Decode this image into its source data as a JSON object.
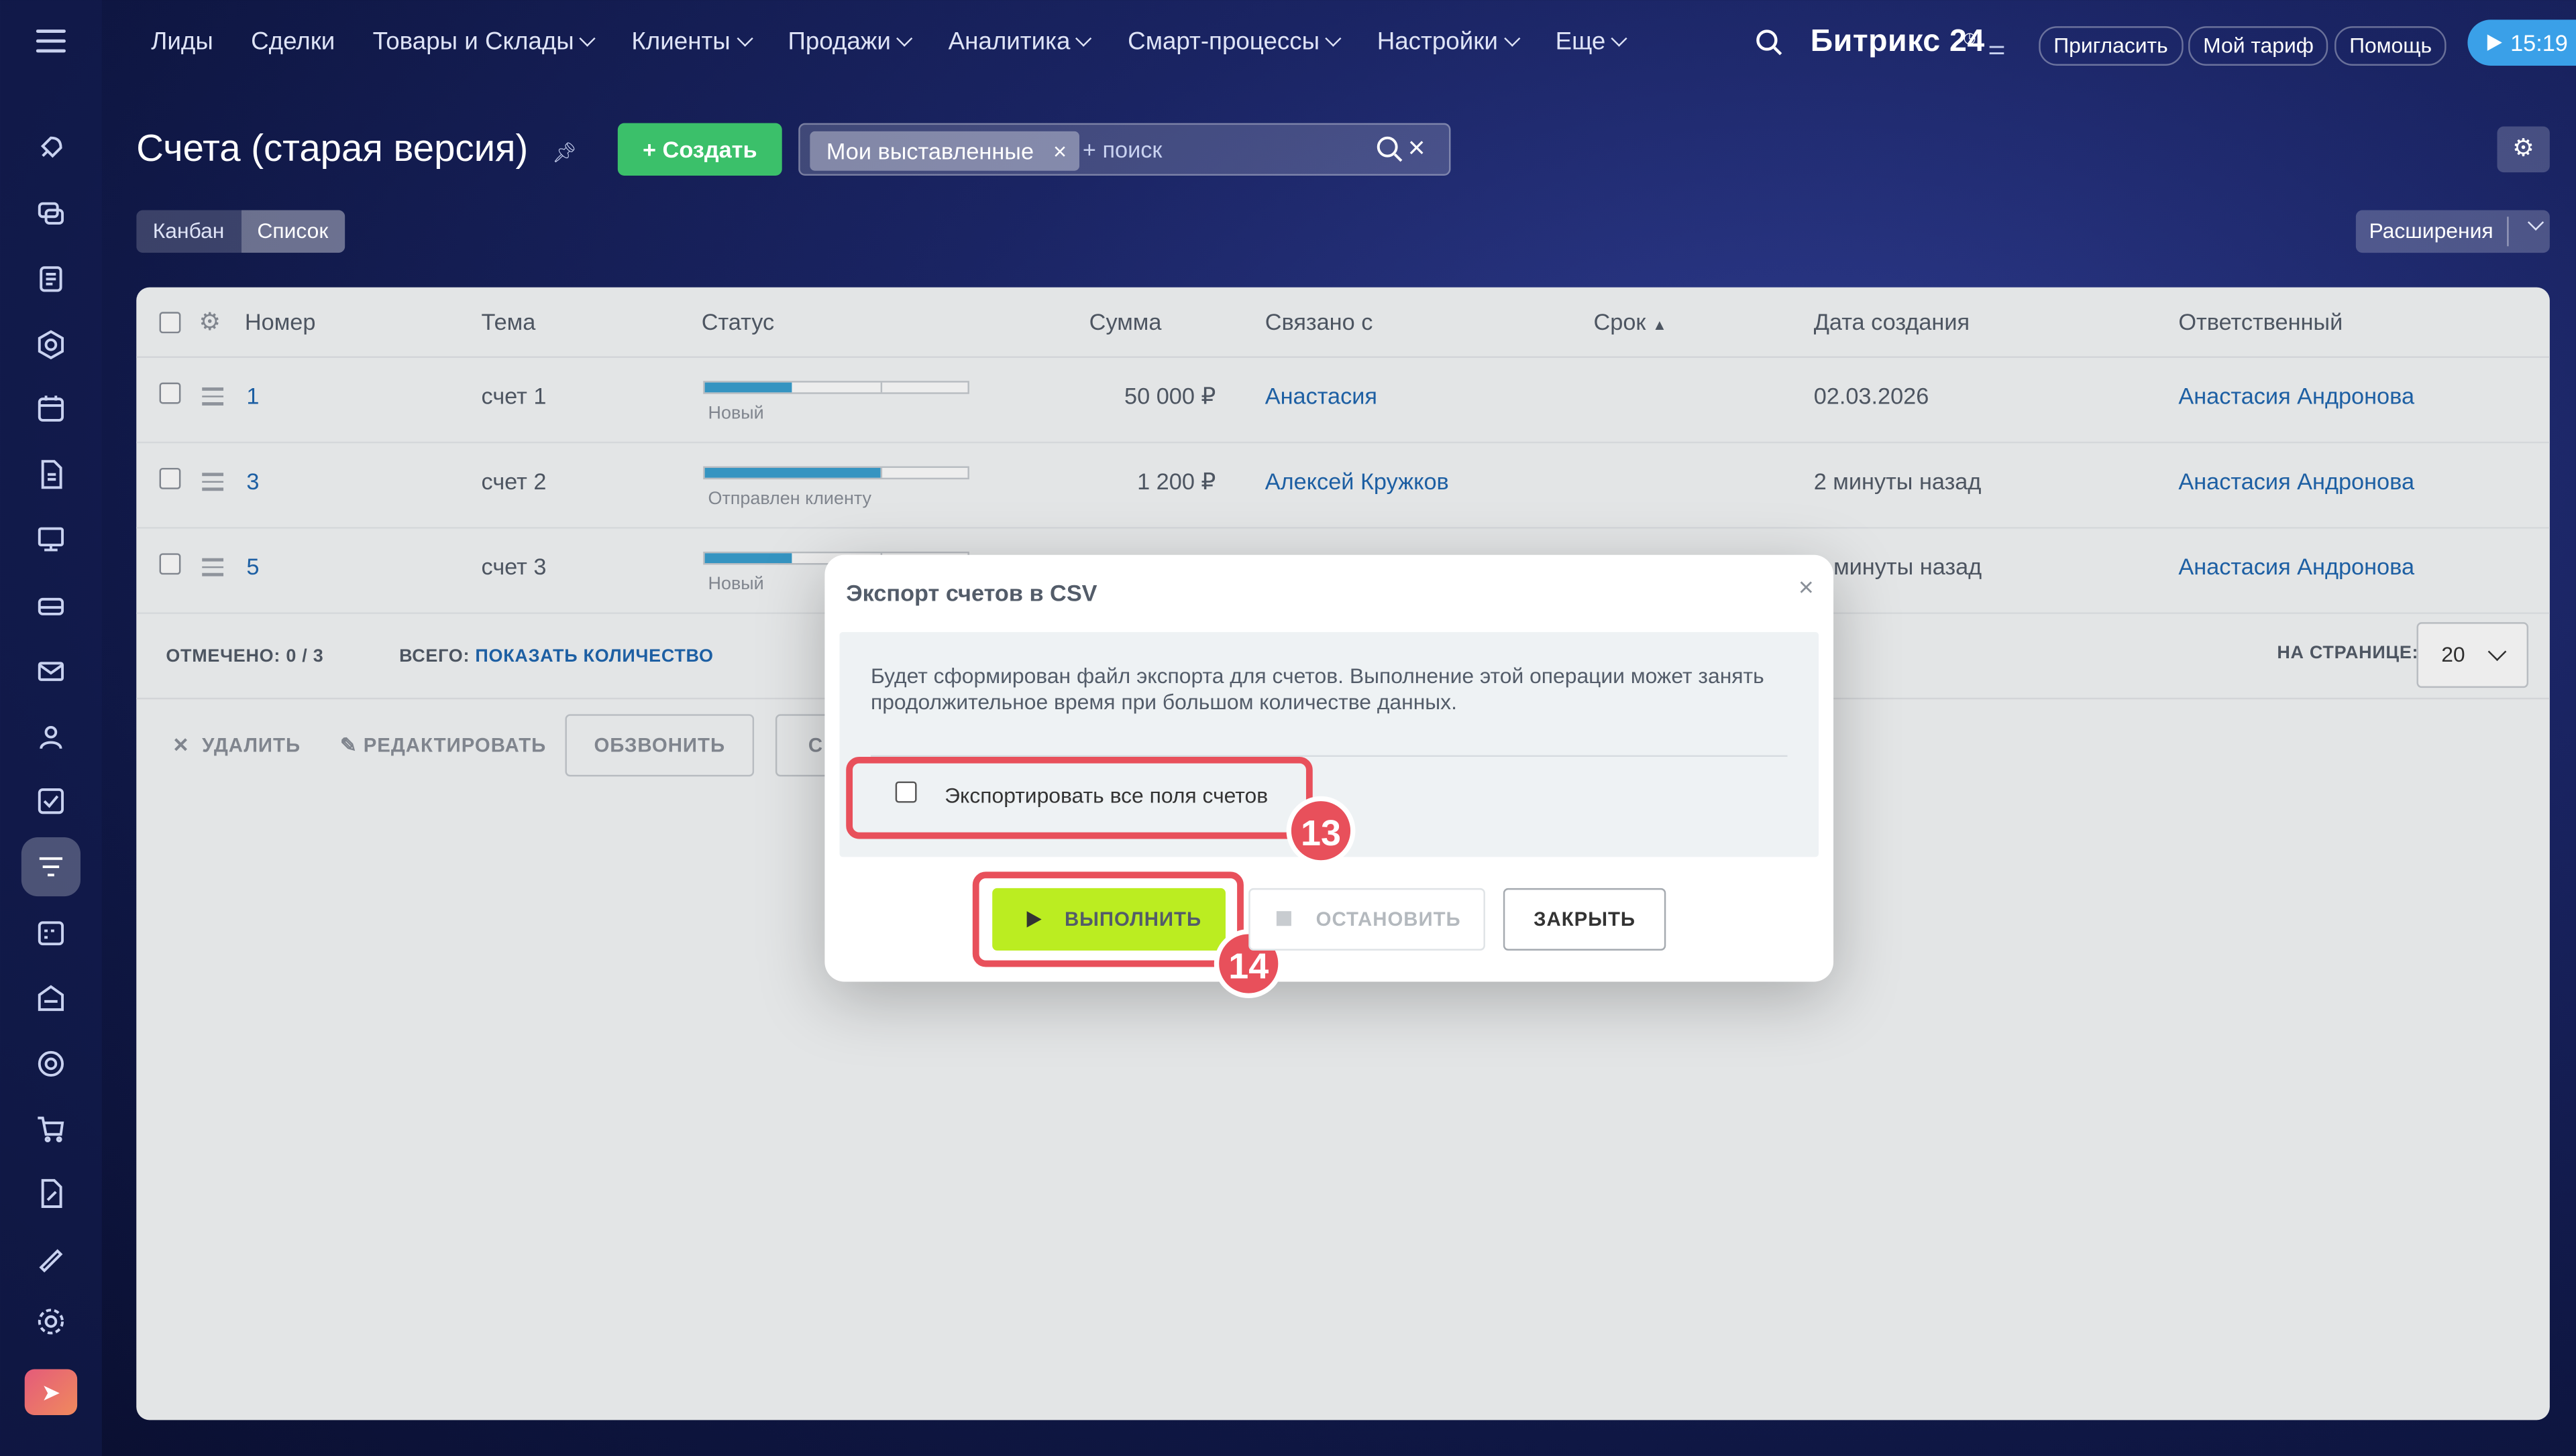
{
  "topnav": {
    "items": [
      "Лиды",
      "Сделки",
      "Товары и Склады",
      "Клиенты",
      "Продажи",
      "Аналитика",
      "Смарт-процессы",
      "Настройки",
      "Еще"
    ],
    "brand": "Битрикс 24",
    "invite": "Пригласить",
    "tariff": "Мой тариф",
    "help": "Помощь",
    "time": "15:19"
  },
  "header": {
    "title": "Счета (старая версия)",
    "create": "Создать",
    "filter_chip": "Мои выставленные",
    "search_placeholder": "+ поиск",
    "view_kanban": "Канбан",
    "view_list": "Список",
    "extensions": "Расширения"
  },
  "table": {
    "columns": [
      "Номер",
      "Тема",
      "Статус",
      "Сумма",
      "Связано с",
      "Срок",
      "Дата создания",
      "Ответственный"
    ],
    "rows": [
      {
        "num": "1",
        "topic": "счет 1",
        "status": "Новый",
        "progress": 0.33,
        "sum": "50 000 ₽",
        "related": "Анастасия",
        "created": "02.03.2026",
        "owner": "Анастасия Андронова"
      },
      {
        "num": "3",
        "topic": "счет 2",
        "status": "Отправлен клиенту",
        "progress": 0.66,
        "sum": "1 200 ₽",
        "related": "Алексей Кружков",
        "created": "2 минуты назад",
        "owner": "Анастасия Андронова"
      },
      {
        "num": "5",
        "topic": "счет 3",
        "status": "Новый",
        "progress": 0.33,
        "sum": "",
        "related": "",
        "created": "минуты назад",
        "owner": "Анастасия Андронова"
      }
    ],
    "selected_label": "ОТМЕЧЕНО:",
    "selected_value": "0 / 3",
    "total_label": "ВСЕГО:",
    "total_link": "ПОКАЗАТЬ КОЛИЧЕСТВО",
    "per_page_label": "НА СТРАНИЦЕ:",
    "per_page_value": "20",
    "actions": {
      "delete": "УДАЛИТЬ",
      "edit": "РЕДАКТИРОВАТЬ",
      "call": "ОБЗВОНИТЬ",
      "more": "С"
    }
  },
  "modal": {
    "title": "Экспорт счетов в CSV",
    "text": "Будет сформирован файл экспорта для счетов. Выполнение этой операции может занять продолжительное время при большом количестве данных.",
    "checkbox_label": "Экспортировать все поля счетов",
    "run": "ВЫПОЛНИТЬ",
    "stop": "ОСТАНОВИТЬ",
    "close": "ЗАКРЫТЬ",
    "badge1": "13",
    "badge2": "14"
  },
  "colors": {
    "accent": "#e8505b",
    "run": "#bbed21",
    "create": "#3bc06a",
    "link": "#2067b0"
  }
}
